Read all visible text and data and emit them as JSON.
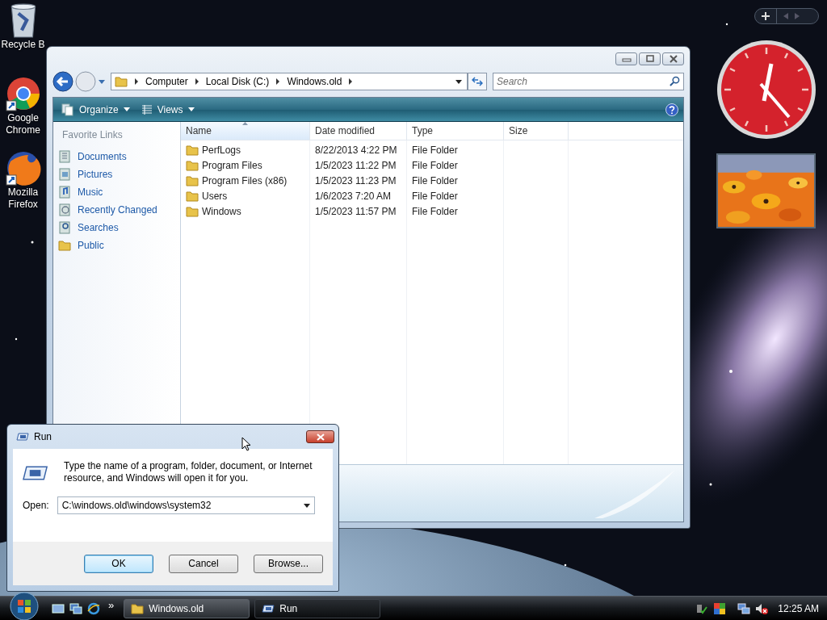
{
  "desktop_icons": [
    {
      "label": "Recycle B",
      "kind": "trash"
    },
    {
      "label": "Google Chrome",
      "kind": "wheel"
    },
    {
      "label": "Mozilla Firefox",
      "kind": "orb"
    }
  ],
  "explorer": {
    "breadcrumb": [
      "Computer",
      "Local Disk (C:)",
      "Windows.old"
    ],
    "search": {
      "placeholder": "Search"
    },
    "toolbar": [
      {
        "label": "Organize",
        "kind": "organize"
      },
      {
        "label": "Views",
        "kind": "views"
      }
    ],
    "favorite_links": {
      "title": "Favorite Links",
      "items": [
        {
          "label": "Documents",
          "kind": "documents"
        },
        {
          "label": "Pictures",
          "kind": "pictures"
        },
        {
          "label": "Music",
          "kind": "music"
        },
        {
          "label": "Recently Changed",
          "kind": "recent"
        },
        {
          "label": "Searches",
          "kind": "searches"
        },
        {
          "label": "Public",
          "kind": "folder"
        }
      ]
    },
    "columns": [
      {
        "label": "Name",
        "sorted": true
      },
      {
        "label": "Date modified",
        "sorted": false
      },
      {
        "label": "Type",
        "sorted": false
      },
      {
        "label": "Size",
        "sorted": false
      }
    ],
    "rows": [
      {
        "name": "PerfLogs",
        "date": "8/22/2013 4:22 PM",
        "type": "File Folder"
      },
      {
        "name": "Program Files",
        "date": "1/5/2023 11:22 PM",
        "type": "File Folder"
      },
      {
        "name": "Program Files (x86)",
        "date": "1/5/2023 11:23 PM",
        "type": "File Folder"
      },
      {
        "name": "Users",
        "date": "1/6/2023 7:20 AM",
        "type": "File Folder"
      },
      {
        "name": "Windows",
        "date": "1/5/2023 11:57 PM",
        "type": "File Folder"
      }
    ]
  },
  "run_dialog": {
    "title": "Run",
    "message": "Type the name of a program, folder, document, or Internet resource, and Windows will open it for you.",
    "open_label": "Open:",
    "value": "C:\\windows.old\\windows\\system32",
    "buttons": [
      {
        "label": "OK",
        "default": true
      },
      {
        "label": "Cancel",
        "default": false
      },
      {
        "label": "Browse...",
        "default": false
      }
    ]
  },
  "taskbar": {
    "chevron": "»",
    "tasks": [
      {
        "label": "Windows.old",
        "kind": "folder",
        "active": false
      },
      {
        "label": "Run",
        "kind": "run",
        "active": true
      }
    ],
    "clock": "12:25 AM"
  }
}
